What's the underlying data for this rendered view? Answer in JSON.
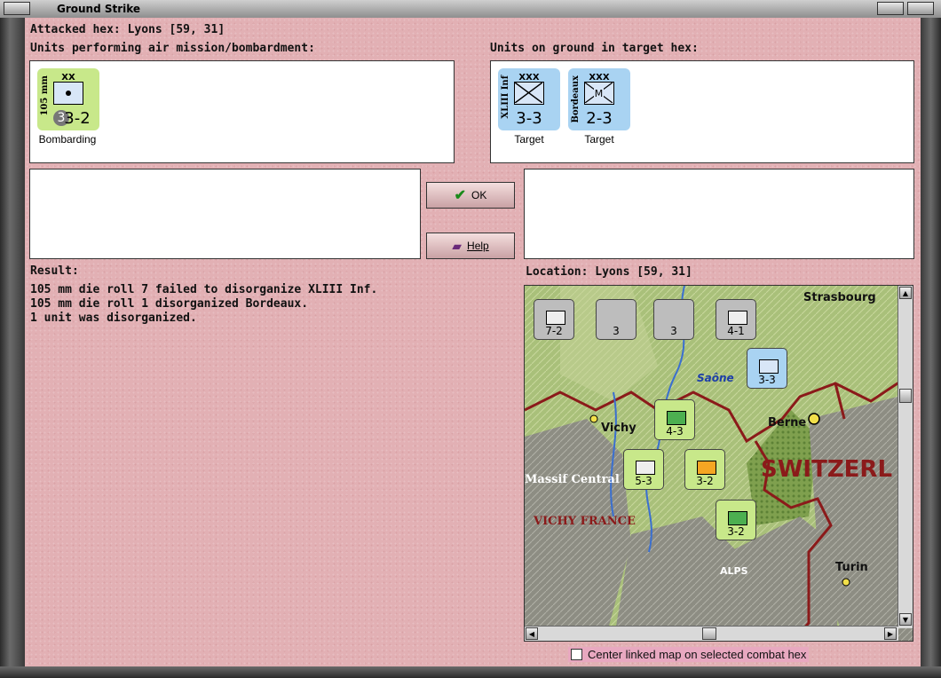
{
  "window": {
    "title": "Ground Strike"
  },
  "header": {
    "attacked_hex": "Attacked hex: Lyons  [59, 31]"
  },
  "attackers": {
    "label": "Units performing air mission/bombardment:",
    "units": [
      {
        "name": "105 mm",
        "size": "XX",
        "strength": "3-2",
        "status": "Bombarding",
        "color": "#c8e88a"
      }
    ]
  },
  "defenders": {
    "label": "Units on ground in target hex:",
    "units": [
      {
        "name": "XLIII Inf",
        "size": "XXX",
        "strength": "3-3",
        "status": "Target",
        "color": "#a9d3f2"
      },
      {
        "name": "Bordeaux",
        "size": "XXX",
        "strength": "2-3",
        "status": "Target",
        "color": "#a9d3f2"
      }
    ]
  },
  "buttons": {
    "ok": "OK",
    "help": "Help"
  },
  "result": {
    "label": "Result:",
    "lines": [
      "105 mm die roll 7 failed to disorganize XLIII Inf.",
      "105 mm die roll 1 disorganized Bordeaux.",
      "1 unit was disorganized."
    ]
  },
  "location": {
    "label": "Location:  Lyons  [59, 31]"
  },
  "map": {
    "places": [
      "Strasbourg",
      "Saône",
      "Vichy",
      "Berne",
      "SWITZERL",
      "Massif Central",
      "VICHY FRANCE",
      "ALPS",
      "Turin"
    ],
    "counters": [
      {
        "strength": "7-2",
        "color": "#bdbdbd"
      },
      {
        "strength": "3",
        "color": "#bdbdbd"
      },
      {
        "strength": "3",
        "color": "#bdbdbd"
      },
      {
        "strength": "4-1",
        "color": "#bdbdbd"
      },
      {
        "strength": "3-3",
        "color": "#a9d3f2"
      },
      {
        "strength": "4-3",
        "color": "#c8e88a"
      },
      {
        "strength": "5-3",
        "color": "#c8e88a"
      },
      {
        "strength": "3-2",
        "color": "#c8e88a"
      },
      {
        "strength": "3-2",
        "color": "#c8e88a"
      }
    ]
  },
  "footer": {
    "center_map_label": "Center linked map on selected combat hex",
    "center_map_checked": false
  },
  "colors": {
    "panel_bg": "#e2b0b4",
    "border_red": "#8b1a1a"
  }
}
